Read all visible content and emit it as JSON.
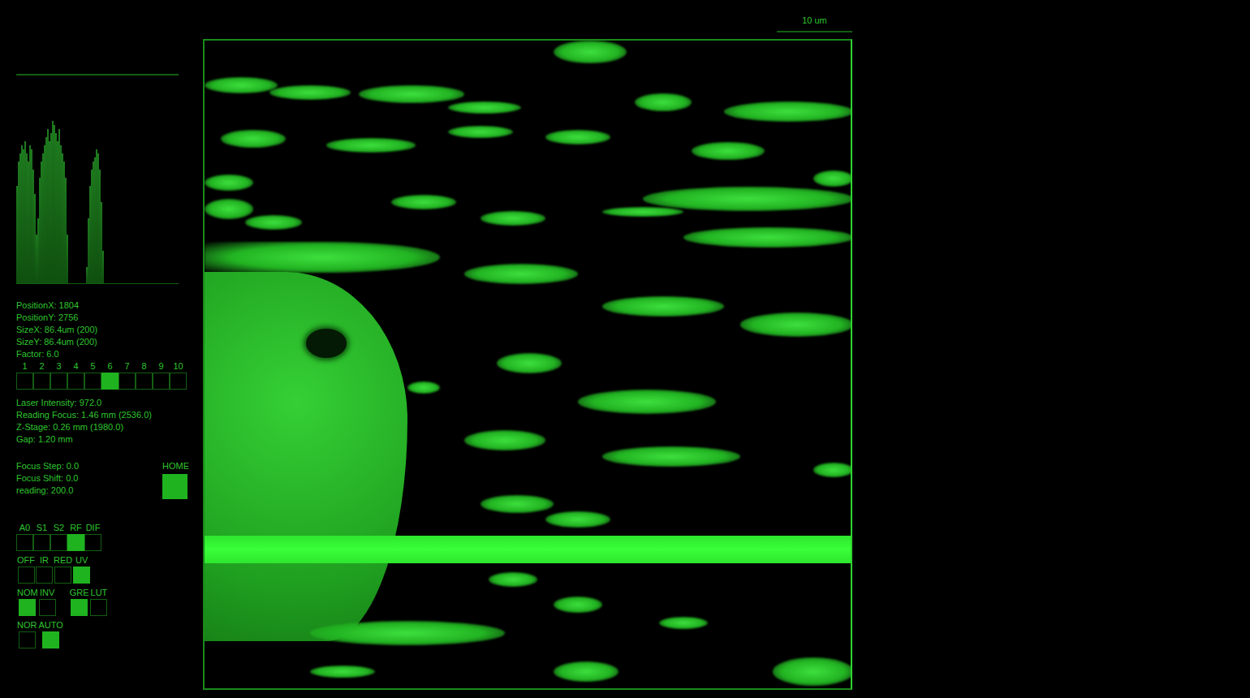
{
  "scale_bar": {
    "label": "10 um"
  },
  "histogram": {
    "values": [
      120,
      150,
      160,
      170,
      165,
      175,
      160,
      150,
      170,
      165,
      140,
      110,
      60,
      80,
      130,
      150,
      160,
      170,
      180,
      190,
      175,
      185,
      200,
      195,
      185,
      175,
      190,
      170,
      160,
      150,
      130,
      60,
      0,
      0,
      0,
      0,
      0,
      0,
      0,
      0,
      0,
      0,
      0,
      20,
      80,
      120,
      140,
      150,
      155,
      165,
      160,
      140,
      100,
      40,
      0,
      0,
      0,
      0,
      0,
      0,
      0,
      0,
      0,
      0,
      0,
      0,
      0,
      0,
      0,
      0,
      0,
      0,
      0,
      0,
      0,
      0,
      0,
      0,
      0,
      0,
      0,
      0,
      0,
      0,
      0,
      0,
      0,
      0,
      0,
      0,
      0,
      0,
      0,
      0,
      0,
      0,
      0,
      0,
      0,
      0
    ]
  },
  "readouts": [
    "PositionX: 1804",
    "PositionY: 2756",
    "SizeX: 86.4um (200)",
    "SizeY: 86.4um (200)",
    "Factor: 6.0"
  ],
  "factor_selector": {
    "items": [
      {
        "label": "1",
        "selected": false
      },
      {
        "label": "2",
        "selected": false
      },
      {
        "label": "3",
        "selected": false
      },
      {
        "label": "4",
        "selected": false
      },
      {
        "label": "5",
        "selected": false
      },
      {
        "label": "6",
        "selected": true
      },
      {
        "label": "7",
        "selected": false
      },
      {
        "label": "8",
        "selected": false
      },
      {
        "label": "9",
        "selected": false
      },
      {
        "label": "10",
        "selected": false
      }
    ]
  },
  "status": [
    "Laser Intensity: 972.0",
    "Reading Focus: 1.46 mm (2536.0)",
    "Z-Stage: 0.26 mm (1980.0)",
    "Gap: 1.20 mm"
  ],
  "focus": [
    "Focus Step: 0.0",
    "Focus Shift: 0.0",
    "reading: 200.0"
  ],
  "home_button": {
    "label": "HOME"
  },
  "toggle_rows": [
    {
      "groups": [
        {
          "items": [
            {
              "label": "A0",
              "selected": false
            },
            {
              "label": "S1",
              "selected": false
            },
            {
              "label": "S2",
              "selected": false
            },
            {
              "label": "RF",
              "selected": true
            },
            {
              "label": "DIF",
              "selected": false
            }
          ]
        }
      ]
    },
    {
      "groups": [
        {
          "items": [
            {
              "label": "OFF",
              "selected": false
            },
            {
              "label": "IR",
              "selected": false
            },
            {
              "label": "RED",
              "selected": false
            },
            {
              "label": "UV",
              "selected": true
            }
          ]
        }
      ]
    },
    {
      "groups": [
        {
          "items": [
            {
              "label": "NOM",
              "selected": true
            },
            {
              "label": "INV",
              "selected": false
            }
          ]
        },
        {
          "items": [
            {
              "label": "GRE",
              "selected": true
            },
            {
              "label": "LUT",
              "selected": false
            }
          ]
        }
      ]
    },
    {
      "groups": [
        {
          "items": [
            {
              "label": "NOR",
              "selected": false
            },
            {
              "label": "AUTO",
              "selected": true
            }
          ]
        }
      ]
    }
  ]
}
